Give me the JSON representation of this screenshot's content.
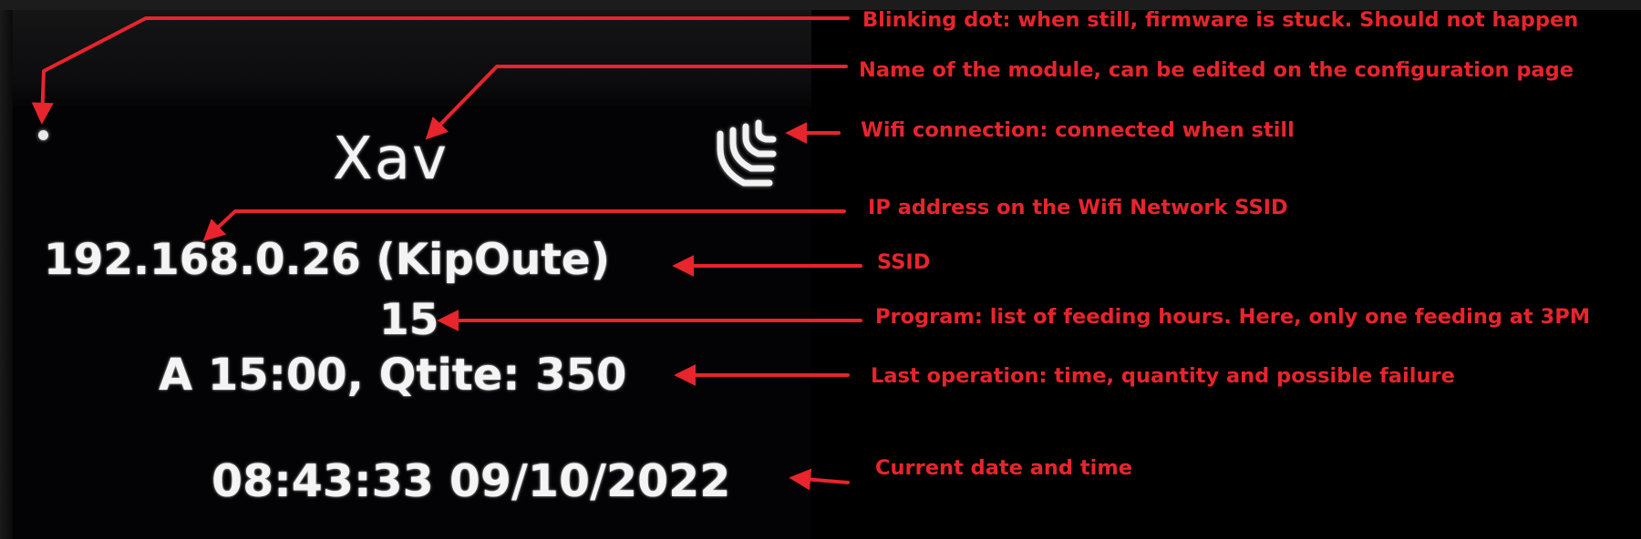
{
  "display": {
    "module_name": "Xav",
    "ip_line": "192.168.0.26 (KipOute)",
    "program": "15",
    "last_operation": "A 15:00, Qtite: 350",
    "datetime": "08:43:33 09/10/2022",
    "indicators": {
      "blinking_dot": "dot-icon",
      "wifi": "wifi-icon"
    }
  },
  "annotations": [
    {
      "id": "blinking-dot",
      "text": "Blinking dot: when still, firmware is stuck. Should not happen"
    },
    {
      "id": "module-name",
      "text": "Name of the module, can be edited on the configuration page"
    },
    {
      "id": "wifi",
      "text": "Wifi connection: connected when still"
    },
    {
      "id": "ip-address",
      "text": "IP address on the Wifi Network SSID"
    },
    {
      "id": "ssid",
      "text": "SSID"
    },
    {
      "id": "program",
      "text": "Program: list of feeding hours. Here, only one feeding at 3PM"
    },
    {
      "id": "last-operation",
      "text": "Last operation: time, quantity and possible failure"
    },
    {
      "id": "current-datetime",
      "text": "Current date and time"
    }
  ],
  "colors": {
    "annotation": "#e8242d",
    "oled_text": "#f4f4f4",
    "background": "#000000"
  }
}
